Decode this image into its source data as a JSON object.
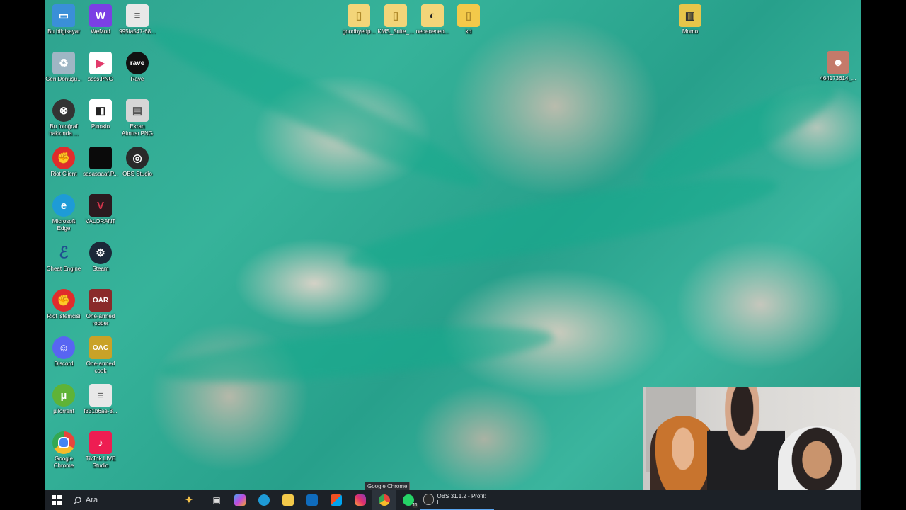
{
  "desktop": {
    "icons_left": [
      {
        "label": "Bu bilgisayar",
        "icon": "computer-icon",
        "color": "#3a8fd8"
      },
      {
        "label": "WeMod",
        "icon": "wemod-icon",
        "color": "#7b3fe4"
      },
      {
        "label": "995fa547-68...",
        "icon": "file-icon",
        "color": "#e8e8e8"
      },
      {
        "label": "Geri Dönüşü...",
        "icon": "recycle-bin-icon",
        "color": "#9fb6c4"
      },
      {
        "label": "ssss.PNG",
        "icon": "image-file-icon",
        "color": "#e23a6b"
      },
      {
        "label": "Rave",
        "icon": "rave-icon",
        "color": "#111111"
      },
      {
        "label": "Bu fotoğraf hakkında ...",
        "icon": "camera-icon",
        "color": "#333333"
      },
      {
        "label": "Pinokio",
        "icon": "pinokio-icon",
        "color": "#222222"
      },
      {
        "label": "Ekran Alıntısı.PNG",
        "icon": "screenshot-file-icon",
        "color": "#d6d6d6"
      },
      {
        "label": "Riot Client",
        "icon": "riot-client-icon",
        "color": "#e02c2c"
      },
      {
        "label": "sasasaaaf.P...",
        "icon": "dark-image-icon",
        "color": "#0a0a0a"
      },
      {
        "label": "OBS Studio",
        "icon": "obs-icon",
        "color": "#2a2a2a"
      },
      {
        "label": "Microsoft Edge",
        "icon": "edge-icon",
        "color": "#1e9bd7"
      },
      {
        "label": "VALORANT",
        "icon": "valorant-icon",
        "color": "#d3344a"
      },
      {
        "label": "Cheat Engine",
        "icon": "cheat-engine-icon",
        "color": "#1f4f8f"
      },
      {
        "label": "Steam",
        "icon": "steam-icon",
        "color": "#1b2838"
      },
      {
        "label": "Riot istemcisi",
        "icon": "riot-icon",
        "color": "#e02c2c"
      },
      {
        "label": "One-armed robber",
        "icon": "slot-machine-icon",
        "color": "#8a2a2a"
      },
      {
        "label": "Discord",
        "icon": "discord-icon",
        "color": "#5865f2"
      },
      {
        "label": "One-armed cook",
        "icon": "cook-game-icon",
        "color": "#c9a227"
      },
      {
        "label": "µTorrent",
        "icon": "utorrent-icon",
        "color": "#5fb336"
      },
      {
        "label": "f331b6ae-3...",
        "icon": "file-icon",
        "color": "#e8e8e8"
      },
      {
        "label": "Google Chrome",
        "icon": "chrome-icon",
        "color": "#e8453c"
      },
      {
        "label": "TikTok LIVE Studio",
        "icon": "tiktok-icon",
        "color": "#ee1d52"
      }
    ],
    "icons_top": [
      {
        "label": "goodbyedp...",
        "icon": "folder-icon",
        "color": "#f3d579"
      },
      {
        "label": "KMS_Suite_...",
        "icon": "folder-icon",
        "color": "#f3d579"
      },
      {
        "label": "oeoeoeoeo...",
        "icon": "folder-icon",
        "color": "#f3d579"
      },
      {
        "label": "kd",
        "icon": "folder-icon",
        "color": "#f3c94a"
      },
      {
        "label": "Momo",
        "icon": "archive-icon",
        "color": "#e7c54a"
      },
      {
        "label": "464173614_...",
        "icon": "photo-file-icon",
        "color": "#c47a6a"
      }
    ]
  },
  "taskbar": {
    "search_placeholder": "Ara",
    "obs_task_label": "OBS 31.1.2 - Profil: l...",
    "notification_badge": "11",
    "tooltip": "Google Chrome"
  }
}
